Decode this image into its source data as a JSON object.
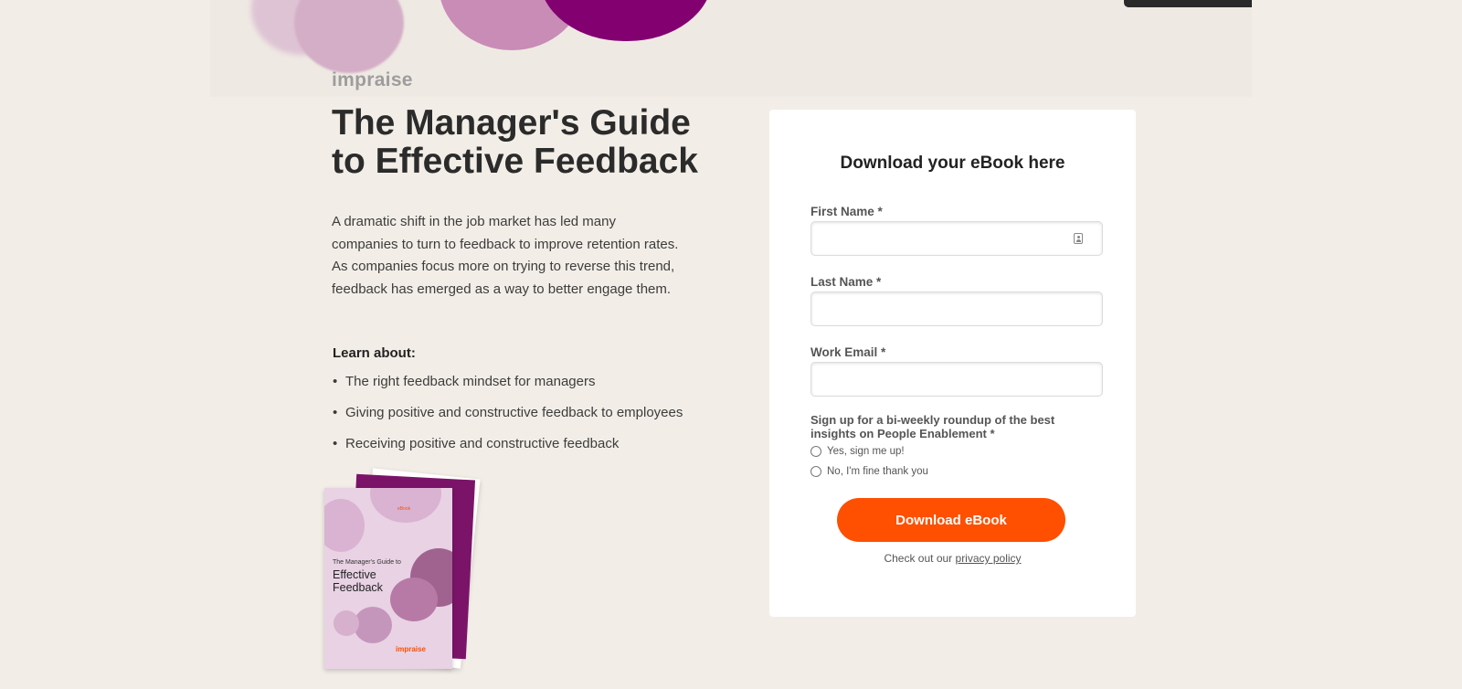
{
  "brand": {
    "logo_text": "impraise"
  },
  "hero": {
    "title_lines": [
      "The Manager's Guide",
      "to Effective Feedback"
    ],
    "intro_lines": [
      "A dramatic shift in the job market has led many",
      "companies to turn to feedback to improve retention rates.",
      "As companies focus more on trying to reverse this trend,",
      "feedback has emerged as a way to better engage them."
    ],
    "learn_heading": "Learn about:",
    "learn_bullet": "•",
    "learn_items": [
      "The right feedback mindset for managers",
      "Giving positive and constructive feedback to employees",
      "Receiving positive and constructive feedback"
    ]
  },
  "book_cover": {
    "tag": "eBook",
    "subtitle": "The Manager's Guide to",
    "title_lines": [
      "Effective",
      "Feedback"
    ],
    "brand": "impraise"
  },
  "form": {
    "heading": "Download your eBook here",
    "required_mark": "*",
    "fields": [
      {
        "label": "First Name",
        "value": ""
      },
      {
        "label": "Last Name",
        "value": ""
      },
      {
        "label": "Work Email",
        "value": ""
      }
    ],
    "signup_question": "Sign up for a bi-weekly roundup of the best insights on People Enablement",
    "signup_options": [
      {
        "label": "Yes, sign me up!",
        "selected": false
      },
      {
        "label": "No, I'm fine thank you",
        "selected": false
      }
    ],
    "submit_label": "Download eBook",
    "privacy_prefix": "Check out our",
    "privacy_link": "privacy policy"
  },
  "colors": {
    "page_background": "#f2eee7",
    "accent": "#ff4f00",
    "brand_purple": "#830070"
  }
}
